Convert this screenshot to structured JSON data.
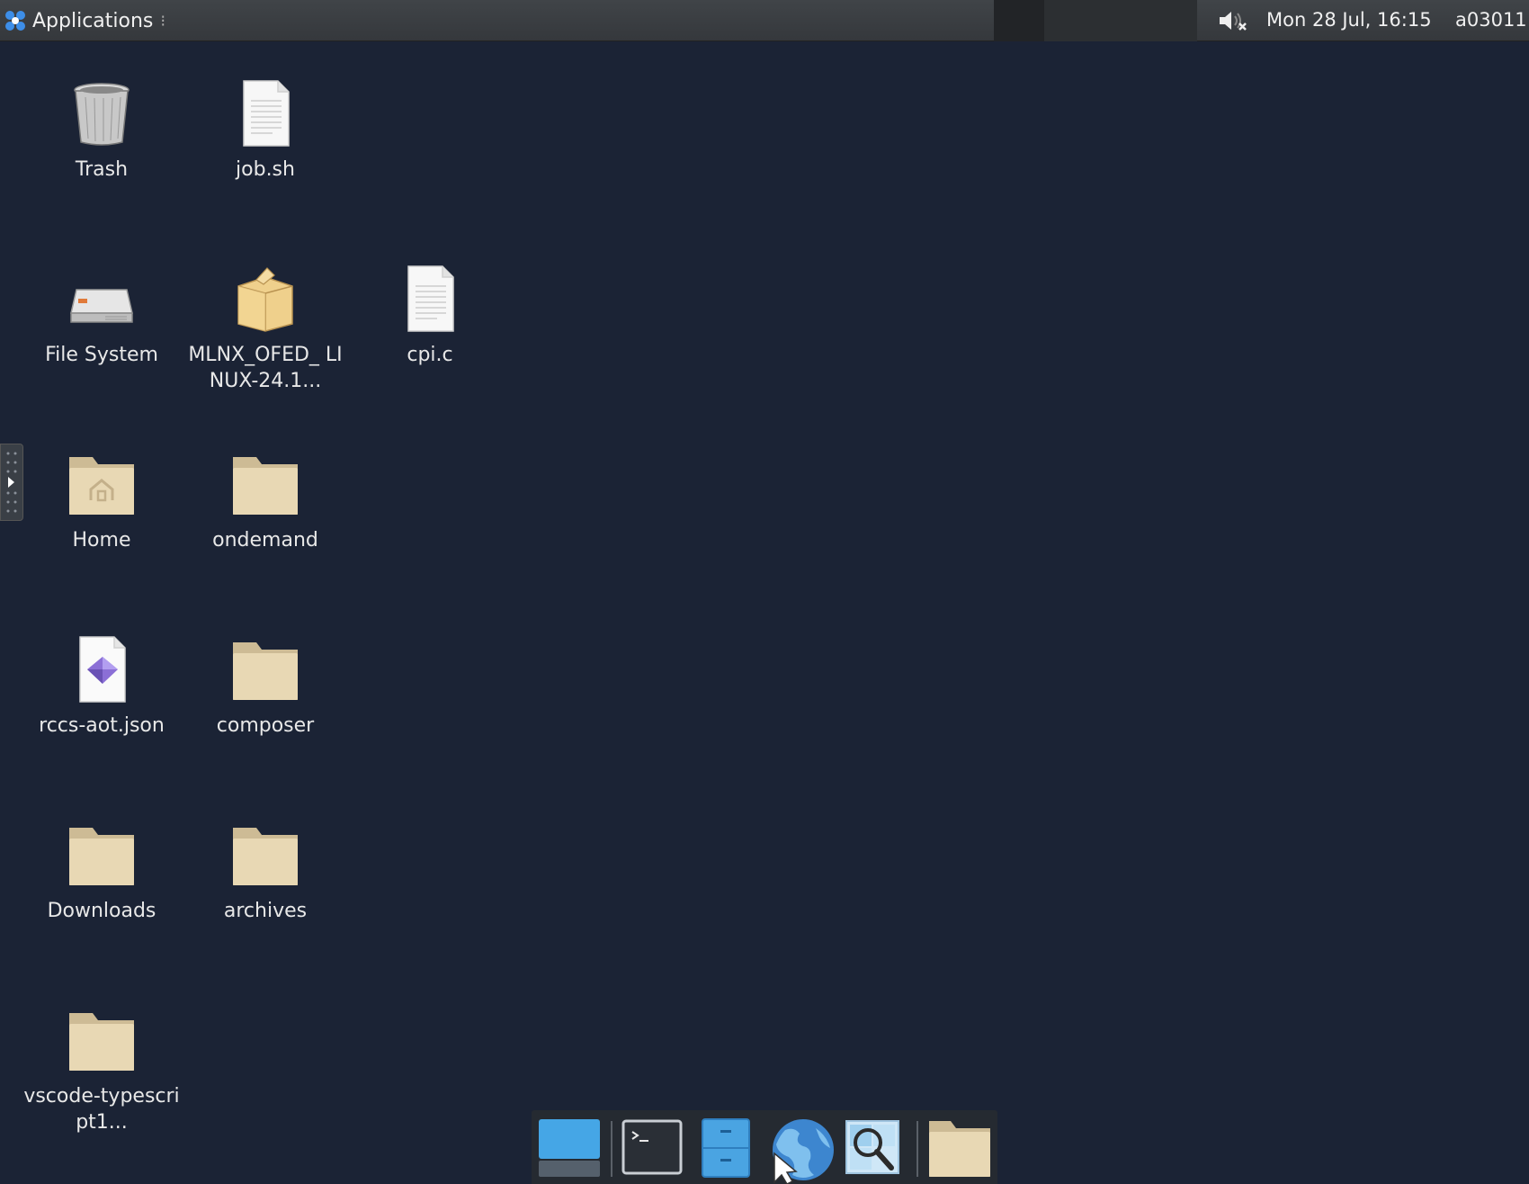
{
  "panel": {
    "applications_label": "Applications",
    "clock": "Mon 28 Jul, 16:15",
    "user": "a03011"
  },
  "desktop": {
    "trash": "Trash",
    "job_sh": "job.sh",
    "file_system": "File System",
    "mlnx": "MLNX_OFED_ LINUX-24.1...",
    "cpi_c": "cpi.c",
    "home": "Home",
    "ondemand": "ondemand",
    "rccs": "rccs-aot.json",
    "composer": "composer",
    "downloads": "Downloads",
    "archives": "archives",
    "vscode": "vscode-typescript1..."
  },
  "dock": {
    "items": [
      "show-desktop-icon",
      "terminal-icon",
      "file-manager-icon",
      "web-browser-icon",
      "app-finder-icon",
      "folder-icon"
    ]
  },
  "colors": {
    "desktop_bg": "#1b2335",
    "folder": "#e8d8b4"
  }
}
